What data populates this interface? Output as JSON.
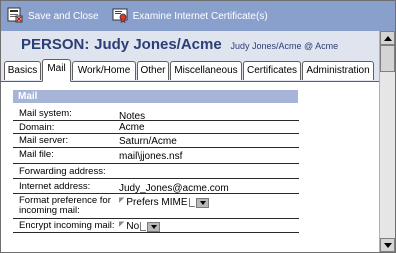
{
  "toolbar": {
    "save_close_label": "Save and Close",
    "examine_cert_label": "Examine Internet Certificate(s)"
  },
  "header": {
    "label": "PERSON",
    "name": "Judy Jones/Acme",
    "subtitle": "Judy Jones/Acme @ Acme"
  },
  "tabs": [
    {
      "label": "Basics"
    },
    {
      "label": "Mail"
    },
    {
      "label": "Work/Home"
    },
    {
      "label": "Other"
    },
    {
      "label": "Miscellaneous"
    },
    {
      "label": "Certificates"
    },
    {
      "label": "Administration"
    }
  ],
  "active_tab": "Mail",
  "section": {
    "title": "Mail"
  },
  "fields": [
    {
      "label": "Mail system:",
      "value": "Notes"
    },
    {
      "label": "Domain:",
      "value": "Acme"
    },
    {
      "label": "Mail server:",
      "value": "Saturn/Acme"
    },
    {
      "label": "Mail file:",
      "value": "mail\\jjones.nsf"
    },
    {
      "label": "Forwarding address:",
      "value": ""
    },
    {
      "label": "Internet address:",
      "value": "Judy_Jones@acme.com"
    },
    {
      "label": "Format preference for",
      "label2": "incoming mail:",
      "value": "Prefers MIME"
    },
    {
      "label": "Encrypt incoming mail:",
      "value": "No"
    }
  ],
  "colors": {
    "toolbar_bg": "#8aa0cc",
    "header_bg": "#dfe4ef",
    "title_color": "#2b3f77",
    "section_bg": "#a6b4d8"
  }
}
